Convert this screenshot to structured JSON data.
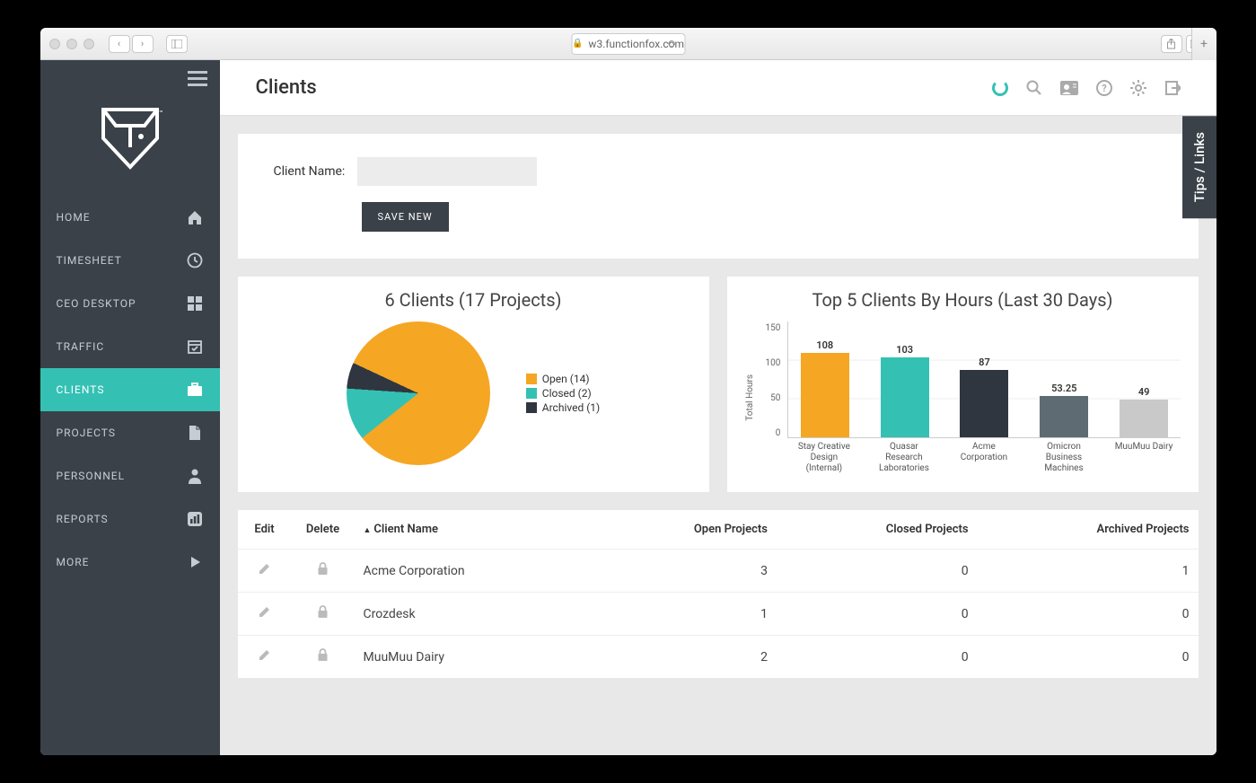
{
  "browser": {
    "url": "w3.functionfox.com"
  },
  "sidebar": {
    "items": [
      {
        "label": "HOME",
        "icon": "home"
      },
      {
        "label": "TIMESHEET",
        "icon": "clock"
      },
      {
        "label": "CEO DESKTOP",
        "icon": "grid"
      },
      {
        "label": "TRAFFIC",
        "icon": "calendar"
      },
      {
        "label": "CLIENTS",
        "icon": "briefcase",
        "active": true
      },
      {
        "label": "PROJECTS",
        "icon": "file"
      },
      {
        "label": "PERSONNEL",
        "icon": "person"
      },
      {
        "label": "REPORTS",
        "icon": "barchart"
      },
      {
        "label": "MORE",
        "icon": "play"
      }
    ]
  },
  "page": {
    "title": "Clients"
  },
  "form": {
    "label": "Client Name:",
    "save": "SAVE NEW"
  },
  "tips": "Tips / Links",
  "pie": {
    "title": "6 Clients (17 Projects)",
    "legend": [
      {
        "label": "Open (14)",
        "color": "#f5a623"
      },
      {
        "label": "Closed (2)",
        "color": "#34c1b4"
      },
      {
        "label": "Archived (1)",
        "color": "#2f3640"
      }
    ]
  },
  "bar": {
    "title": "Top 5 Clients By Hours (Last 30 Days)",
    "ylabel": "Total Hours"
  },
  "chart_data": [
    {
      "type": "pie",
      "title": "6 Clients (17 Projects)",
      "categories": [
        "Open",
        "Closed",
        "Archived"
      ],
      "values": [
        14,
        2,
        1
      ],
      "colors": [
        "#f5a623",
        "#34c1b4",
        "#2f3640"
      ]
    },
    {
      "type": "bar",
      "title": "Top 5 Clients By Hours (Last 30 Days)",
      "ylabel": "Total Hours",
      "ylim": [
        0,
        150
      ],
      "yticks": [
        0,
        50,
        100,
        150
      ],
      "categories": [
        "Stay Creative Design (Internal)",
        "Quasar Research Laboratories",
        "Acme Corporation",
        "Omicron Business Machines",
        "MuuMuu Dairy"
      ],
      "values": [
        108,
        103,
        87,
        53.25,
        49
      ],
      "colors": [
        "#f5a623",
        "#34c1b4",
        "#2f3640",
        "#5f6b72",
        "#c9c9c9"
      ]
    }
  ],
  "table": {
    "headers": {
      "edit": "Edit",
      "delete": "Delete",
      "name": "Client Name",
      "open": "Open Projects",
      "closed": "Closed Projects",
      "archived": "Archived Projects"
    },
    "rows": [
      {
        "name": "Acme Corporation",
        "open": "3",
        "closed": "0",
        "archived": "1"
      },
      {
        "name": "Crozdesk",
        "open": "1",
        "closed": "0",
        "archived": "0"
      },
      {
        "name": "MuuMuu Dairy",
        "open": "2",
        "closed": "0",
        "archived": "0"
      }
    ]
  }
}
